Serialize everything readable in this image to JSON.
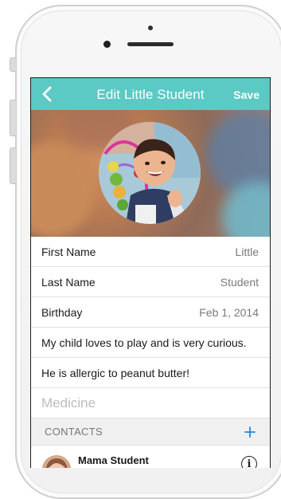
{
  "navbar": {
    "back_icon": "chevron-left-icon",
    "title": "Edit Little Student",
    "save_label": "Save",
    "color": "#5bc9c4"
  },
  "profile": {
    "photo": "child-playing-with-bead-maze"
  },
  "fields": [
    {
      "label": "First Name",
      "value": "Little"
    },
    {
      "label": "Last Name",
      "value": "Student"
    },
    {
      "label": "Birthday",
      "value": "Feb 1, 2014"
    }
  ],
  "notes": [
    "My child loves to play and is very curious.",
    "He is allergic to peanut butter!"
  ],
  "medicine": {
    "placeholder": "Medicine"
  },
  "contacts": {
    "header": "CONTACTS",
    "add_icon": "plus-icon",
    "accent": "#1e88e5",
    "items": [
      {
        "name": "Mama Student",
        "info_icon": "info-icon"
      }
    ]
  }
}
